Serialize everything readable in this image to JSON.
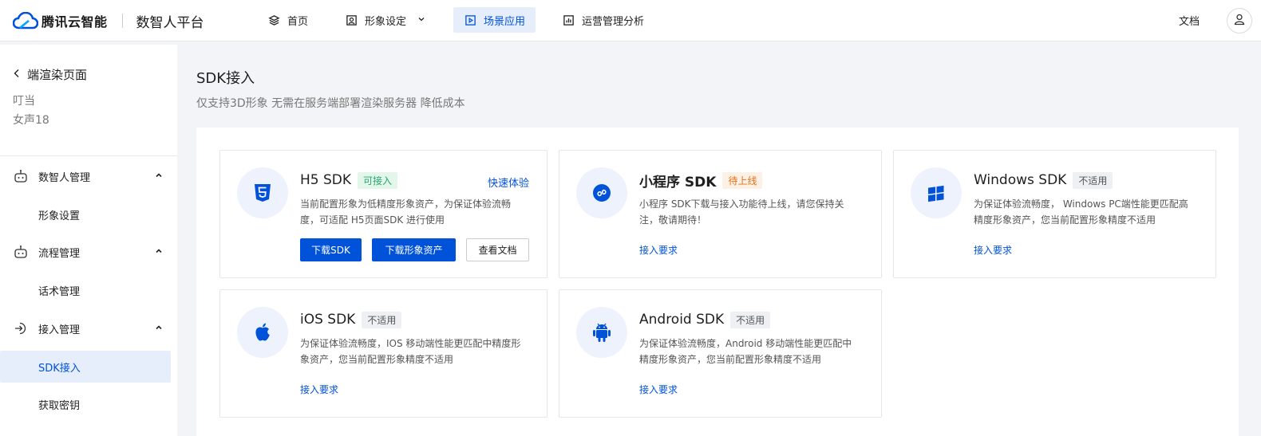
{
  "brand": {
    "name": "腾讯云智能",
    "product": "数智人平台"
  },
  "nav": [
    {
      "label": "首页",
      "icon": "layers-icon"
    },
    {
      "label": "形象设定",
      "icon": "portrait-icon"
    },
    {
      "label": "场景应用",
      "icon": "play-icon",
      "active": true
    },
    {
      "label": "运营管理分析",
      "icon": "bar-chart-icon"
    }
  ],
  "header": {
    "docs": "文档"
  },
  "sidebar": {
    "back_label": "端渲染页面",
    "sub1": "叮当",
    "sub2": "女声18",
    "groups": [
      {
        "label": "数智人管理",
        "items": [
          "形象设置"
        ]
      },
      {
        "label": "流程管理",
        "items": [
          "话术管理"
        ]
      },
      {
        "label": "接入管理",
        "items": [
          "SDK接入",
          "获取密钥"
        ]
      }
    ]
  },
  "main": {
    "title": "SDK接入",
    "subtitle": "仅支持3D形象 无需在服务端部署渲染服务器 降低成本"
  },
  "cards": {
    "h5": {
      "name": "H5 SDK",
      "tag": "可接入",
      "quick": "快速体验",
      "desc1": "当前配置形象为低精度形象资产，为保证体验流畅",
      "desc2": "度，可适配 H5页面SDK 进行使用",
      "btn_download_sdk": "下载SDK",
      "btn_download_assets": "下载形象资产",
      "btn_docs": "查看文档"
    },
    "mini": {
      "name": "小程序 SDK",
      "tag": "待上线",
      "desc1": "小程序 SDK下载与接入功能待上线，请您保持关",
      "desc2": "注，敬请期待！",
      "link": "接入要求"
    },
    "windows": {
      "name": "Windows SDK",
      "tag": "不适用",
      "desc1": "为保证体验流畅度， Windows PC端性能更匹配高",
      "desc2": "精度形象资产，您当前配置形象精度不适用",
      "link": "接入要求"
    },
    "ios": {
      "name": "iOS SDK",
      "tag": "不适用",
      "desc1": "为保证体验流畅度，IOS 移动端性能更匹配中精度形",
      "desc2": "象资产，您当前配置形象精度不适用",
      "link": "接入要求"
    },
    "android": {
      "name": "Android SDK",
      "tag": "不适用",
      "desc1": "为保证体验流畅度，Android 移动端性能更匹配中",
      "desc2": "精度形象资产，您当前配置形象精度不适用",
      "link": "接入要求"
    }
  },
  "colors": {
    "accent": "#0052d9",
    "ok": "#2ba471",
    "warn": "#e37318"
  }
}
